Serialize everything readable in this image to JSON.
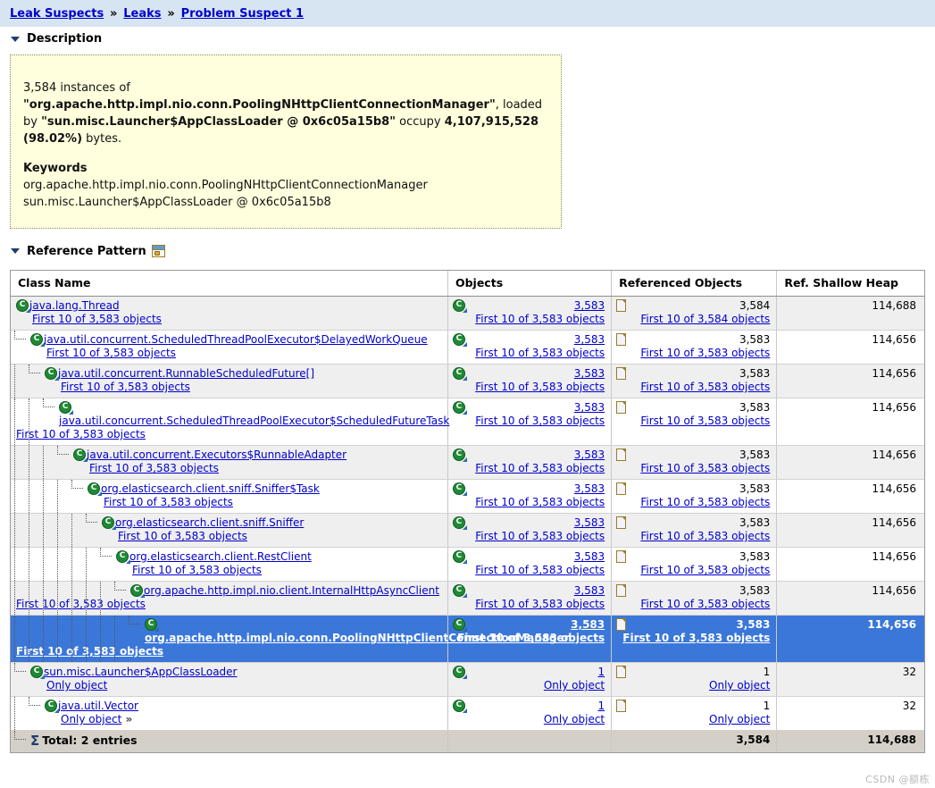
{
  "breadcrumb": {
    "items": [
      "Leak Suspects",
      "Leaks",
      "Problem Suspect 1"
    ],
    "separator": "»"
  },
  "sections": {
    "description_title": "Description",
    "reference_pattern_title": "Reference Pattern",
    "reference_pattern_icon": "window-export-icon"
  },
  "description": {
    "count": "3,584 instances of",
    "class_quoted": "\"org.apache.http.impl.nio.conn.PoolingNHttpClientConnectionManager\"",
    "loaded_by_text": ", loaded by",
    "loader_quoted": "\"sun.misc.Launcher$AppClassLoader @ 0x6c05a15b8\"",
    "occupy_text": "occupy",
    "bytes_value": "4,107,915,528",
    "percent": "(98.02%)",
    "bytes_suffix": "bytes.",
    "keywords_title": "Keywords",
    "keywords": [
      "org.apache.http.impl.nio.conn.PoolingNHttpClientConnectionManager",
      "sun.misc.Launcher$AppClassLoader @ 0x6c05a15b8"
    ]
  },
  "table": {
    "columns": [
      "Class Name",
      "Objects",
      "Referenced Objects",
      "Ref. Shallow Heap"
    ],
    "rows": [
      {
        "depth": 0,
        "wrap": false,
        "class_name": "java.lang.Thread",
        "class_sub": "First 10 of 3,583 objects",
        "objects_count": "3,583",
        "objects_sub": "First 10 of 3,583 objects",
        "referenced_count": "3,584",
        "referenced_sub": "First 10 of 3,584 objects",
        "shallow_heap": "114,688",
        "selected": false,
        "trailing_angle": false
      },
      {
        "depth": 1,
        "wrap": false,
        "class_name": "java.util.concurrent.ScheduledThreadPoolExecutor$DelayedWorkQueue",
        "class_sub": "First 10 of 3,583 objects",
        "objects_count": "3,583",
        "objects_sub": "First 10 of 3,583 objects",
        "referenced_count": "3,583",
        "referenced_sub": "First 10 of 3,583 objects",
        "shallow_heap": "114,656",
        "selected": false,
        "trailing_angle": false
      },
      {
        "depth": 2,
        "wrap": false,
        "class_name": "java.util.concurrent.RunnableScheduledFuture[]",
        "class_sub": "First 10 of 3,583 objects",
        "objects_count": "3,583",
        "objects_sub": "First 10 of 3,583 objects",
        "referenced_count": "3,583",
        "referenced_sub": "First 10 of 3,583 objects",
        "shallow_heap": "114,656",
        "selected": false,
        "trailing_angle": false
      },
      {
        "depth": 3,
        "wrap": true,
        "class_name": "java.util.concurrent.ScheduledThreadPoolExecutor$ScheduledFutureTask",
        "class_sub": "First 10 of 3,583 objects",
        "objects_count": "3,583",
        "objects_sub": "First 10 of 3,583 objects",
        "referenced_count": "3,583",
        "referenced_sub": "First 10 of 3,583 objects",
        "shallow_heap": "114,656",
        "selected": false,
        "trailing_angle": false
      },
      {
        "depth": 4,
        "wrap": false,
        "class_name": "java.util.concurrent.Executors$RunnableAdapter",
        "class_sub": "First 10 of 3,583 objects",
        "objects_count": "3,583",
        "objects_sub": "First 10 of 3,583 objects",
        "referenced_count": "3,583",
        "referenced_sub": "First 10 of 3,583 objects",
        "shallow_heap": "114,656",
        "selected": false,
        "trailing_angle": false
      },
      {
        "depth": 5,
        "wrap": false,
        "class_name": "org.elasticsearch.client.sniff.Sniffer$Task",
        "class_sub": "First 10 of 3,583 objects",
        "objects_count": "3,583",
        "objects_sub": "First 10 of 3,583 objects",
        "referenced_count": "3,583",
        "referenced_sub": "First 10 of 3,583 objects",
        "shallow_heap": "114,656",
        "selected": false,
        "trailing_angle": false
      },
      {
        "depth": 6,
        "wrap": false,
        "class_name": "org.elasticsearch.client.sniff.Sniffer",
        "class_sub": "First 10 of 3,583 objects",
        "objects_count": "3,583",
        "objects_sub": "First 10 of 3,583 objects",
        "referenced_count": "3,583",
        "referenced_sub": "First 10 of 3,583 objects",
        "shallow_heap": "114,656",
        "selected": false,
        "trailing_angle": false
      },
      {
        "depth": 7,
        "wrap": false,
        "class_name": "org.elasticsearch.client.RestClient",
        "class_sub": "First 10 of 3,583 objects",
        "objects_count": "3,583",
        "objects_sub": "First 10 of 3,583 objects",
        "referenced_count": "3,583",
        "referenced_sub": "First 10 of 3,583 objects",
        "shallow_heap": "114,656",
        "selected": false,
        "trailing_angle": false
      },
      {
        "depth": 8,
        "wrap": true,
        "class_name": "org.apache.http.impl.nio.client.InternalHttpAsyncClient",
        "class_sub": "First 10 of 3,583 objects",
        "objects_count": "3,583",
        "objects_sub": "First 10 of 3,583 objects",
        "referenced_count": "3,583",
        "referenced_sub": "First 10 of 3,583 objects",
        "shallow_heap": "114,656",
        "selected": false,
        "trailing_angle": false
      },
      {
        "depth": 9,
        "wrap": true,
        "class_name": "org.apache.http.impl.nio.conn.PoolingNHttpClientConnectionManager",
        "class_sub": "First 10 of 3,583 objects",
        "objects_count": "3,583",
        "objects_sub": "First 10 of 3,583 objects",
        "referenced_count": "3,583",
        "referenced_sub": "First 10 of 3,583 objects",
        "shallow_heap": "114,656",
        "selected": true,
        "trailing_angle": false
      },
      {
        "depth": 1,
        "wrap": false,
        "class_name": "sun.misc.Launcher$AppClassLoader",
        "class_sub": "Only object",
        "objects_count": "1",
        "objects_sub": "Only object",
        "referenced_count": "1",
        "referenced_sub": "Only object",
        "shallow_heap": "32",
        "selected": false,
        "trailing_angle": false
      },
      {
        "depth": 2,
        "wrap": false,
        "class_name": "java.util.Vector",
        "class_sub": "Only object",
        "objects_count": "1",
        "objects_sub": "Only object",
        "referenced_count": "1",
        "referenced_sub": "Only object",
        "shallow_heap": "32",
        "selected": false,
        "trailing_angle": true
      }
    ],
    "total_row": {
      "label": "Total: 2 entries",
      "objects": "",
      "referenced": "3,584",
      "shallow_heap": "114,688"
    }
  },
  "watermark": "CSDN @额栋"
}
